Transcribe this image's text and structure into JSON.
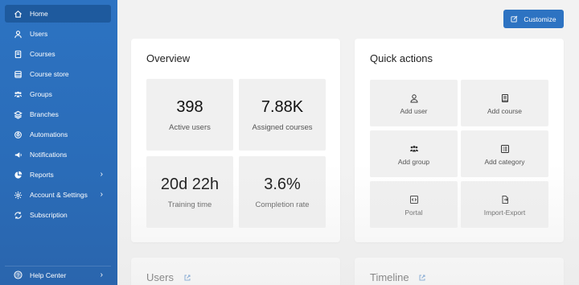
{
  "sidebar": {
    "items": [
      {
        "label": "Home",
        "icon": "home-icon",
        "active": true
      },
      {
        "label": "Users",
        "icon": "user-icon"
      },
      {
        "label": "Courses",
        "icon": "book-icon"
      },
      {
        "label": "Course store",
        "icon": "store-icon"
      },
      {
        "label": "Groups",
        "icon": "group-icon"
      },
      {
        "label": "Branches",
        "icon": "layers-icon"
      },
      {
        "label": "Automations",
        "icon": "automation-icon"
      },
      {
        "label": "Notifications",
        "icon": "megaphone-icon"
      },
      {
        "label": "Reports",
        "icon": "pie-chart-icon",
        "has_submenu": true
      },
      {
        "label": "Account & Settings",
        "icon": "gear-icon",
        "has_submenu": true
      },
      {
        "label": "Subscription",
        "icon": "refresh-icon"
      }
    ],
    "help_label": "Help Center"
  },
  "header": {
    "customize_label": "Customize"
  },
  "overview": {
    "title": "Overview",
    "stats": [
      {
        "value": "398",
        "label": "Active users"
      },
      {
        "value": "7.88K",
        "label": "Assigned courses"
      },
      {
        "value": "20d 22h",
        "label": "Training time"
      },
      {
        "value": "3.6%",
        "label": "Completion rate"
      }
    ]
  },
  "quick_actions": {
    "title": "Quick actions",
    "items": [
      {
        "label": "Add user",
        "icon": "user-icon"
      },
      {
        "label": "Add course",
        "icon": "book-icon"
      },
      {
        "label": "Add group",
        "icon": "group-icon"
      },
      {
        "label": "Add category",
        "icon": "list-icon"
      },
      {
        "label": "Portal",
        "icon": "code-icon"
      },
      {
        "label": "Import-Export",
        "icon": "import-export-icon"
      }
    ]
  },
  "users_card": {
    "title": "Users"
  },
  "timeline_card": {
    "title": "Timeline"
  },
  "colors": {
    "sidebar": "#2d73c2",
    "accent": "#2d73c2",
    "active": "#1e5a9e"
  }
}
